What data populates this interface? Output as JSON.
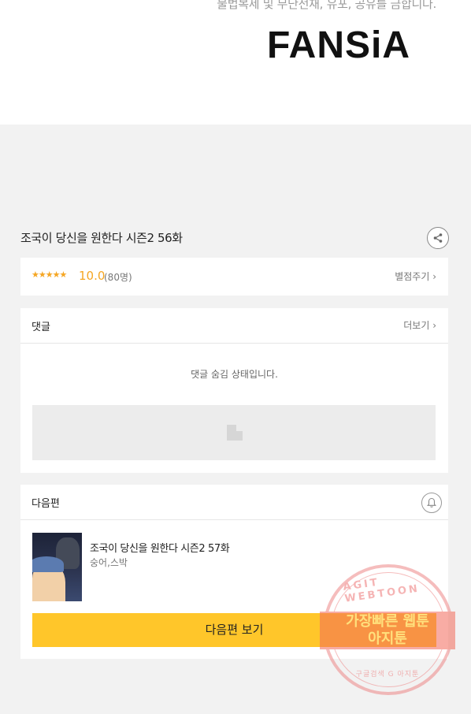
{
  "header": {
    "notice": "불법복제 및 무단전재, 유포, 공유를 금합니다.",
    "logo_text": "FANSiA"
  },
  "episode": {
    "title": "조국이 당신을 원한다 시즌2 56화",
    "share_icon": "share-icon"
  },
  "rating": {
    "stars": "★★★★★",
    "score": "10.0",
    "votes": "(80명)",
    "rate_label": "별점주기 ›",
    "accent_color": "#f5a623"
  },
  "comments": {
    "header": "댓글",
    "more_label": "더보기 ›",
    "hidden_message": "댓글 숨김 상태입니다."
  },
  "next_episode": {
    "header": "다음편",
    "bell_icon": "bell-icon",
    "title": "조국이 당신을 원한다 시즌2 57화",
    "authors": "숭어,스박",
    "button_label": "다음편 보기",
    "button_color": "#ffc62a"
  },
  "watermark": {
    "top_text": "AGIT WEBTOON",
    "line1": "가장빠른 웹툰",
    "line2": "아지툰",
    "bottom_text": "구글검색 G 아지툰"
  }
}
